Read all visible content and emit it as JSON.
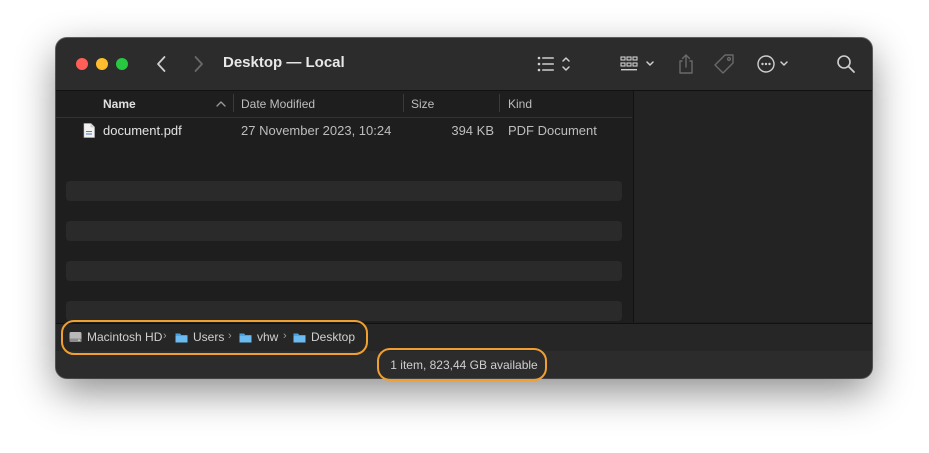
{
  "window": {
    "title": "Desktop — Local"
  },
  "toolbar": {
    "back_icon": "chevron-left-icon",
    "forward_icon": "chevron-right-icon",
    "view_icon": "list-view-icon",
    "group_icon": "grid-group-icon",
    "share_icon": "share-icon",
    "tag_icon": "tag-icon",
    "more_icon": "ellipsis-circle-icon",
    "search_icon": "search-icon"
  },
  "columns": {
    "name": "Name",
    "date": "Date Modified",
    "size": "Size",
    "kind": "Kind"
  },
  "files": [
    {
      "name": "document.pdf",
      "date": "27 November 2023, 10:24",
      "size": "394 KB",
      "kind": "PDF Document"
    }
  ],
  "path": [
    {
      "label": "Macintosh HD",
      "icon": "hard-drive-icon"
    },
    {
      "label": "Users",
      "icon": "folder-icon"
    },
    {
      "label": "vhw",
      "icon": "folder-icon"
    },
    {
      "label": "Desktop",
      "icon": "folder-icon"
    }
  ],
  "status": {
    "text": "1 item, 823,44 GB available"
  },
  "colors": {
    "highlight": "#f0a030",
    "folder": "#4aa3e0"
  }
}
